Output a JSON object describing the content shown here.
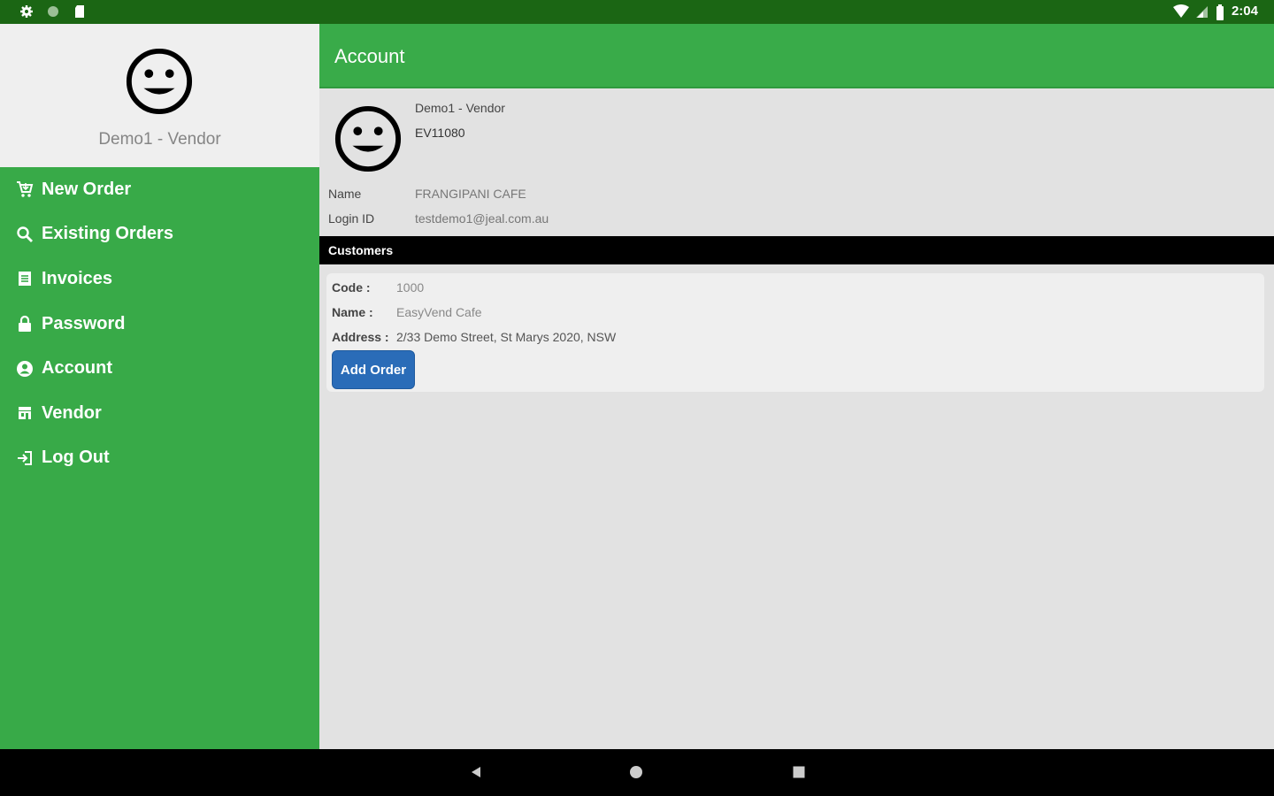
{
  "status_bar": {
    "left_icons": [
      "gear-icon",
      "circle-icon",
      "sd-card-icon"
    ],
    "right_icons": [
      "wifi-icon",
      "signal-icon",
      "battery-icon"
    ],
    "time": "2:04"
  },
  "drawer": {
    "avatar_icon": "smiley-face-icon",
    "username": "Demo1 - Vendor",
    "menu": [
      {
        "label": "New Order",
        "icon": "cart-icon"
      },
      {
        "label": "Existing Orders",
        "icon": "search-icon"
      },
      {
        "label": "Invoices",
        "icon": "document-icon"
      },
      {
        "label": "Password",
        "icon": "lock-icon"
      },
      {
        "label": "Account",
        "icon": "account-icon"
      },
      {
        "label": "Vendor",
        "icon": "store-icon"
      },
      {
        "label": "Log Out",
        "icon": "logout-icon"
      }
    ]
  },
  "appbar": {
    "title": "Account"
  },
  "profile": {
    "avatar_icon": "smiley-face-icon",
    "vendor_name": "Demo1 - Vendor",
    "vendor_code": "EV11080",
    "fields": [
      {
        "label": "Name",
        "value": "FRANGIPANI CAFE"
      },
      {
        "label": "Login ID",
        "value": "testdemo1@jeal.com.au"
      }
    ]
  },
  "customers_section": {
    "title": "Customers",
    "customers": [
      {
        "code_label": "Code :",
        "code": "1000",
        "name_label": "Name :",
        "name": "EasyVend Cafe",
        "address_label": "Address :",
        "address": "2/33 Demo Street, St Marys 2020, NSW",
        "button_label": "Add Order"
      }
    ]
  },
  "nav_bar": {
    "buttons": [
      "back-icon",
      "home-icon",
      "recents-icon"
    ]
  },
  "colors": {
    "status_bar": "#1b6614",
    "primary_green": "#38aa48",
    "button_blue": "#2a6cb8",
    "background": "#e2e2e2"
  }
}
